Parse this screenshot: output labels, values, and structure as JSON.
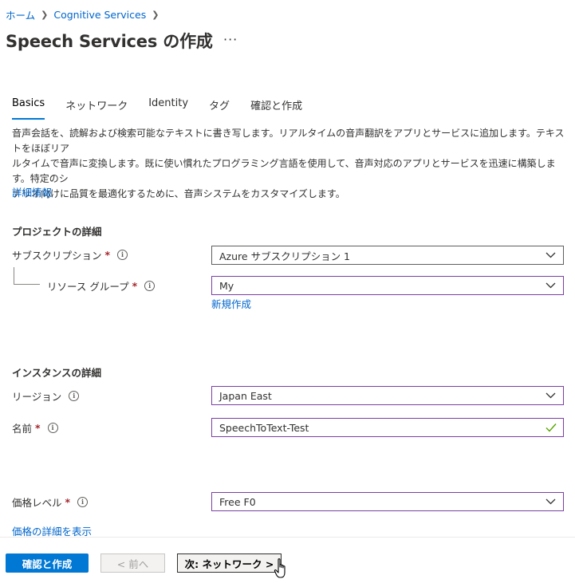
{
  "breadcrumb": {
    "home": "ホーム",
    "current": "Cognitive Services"
  },
  "page": {
    "title": "Speech Services の作成",
    "more": "···"
  },
  "tabs": [
    {
      "label": "Basics"
    },
    {
      "label": "ネットワーク"
    },
    {
      "label": "Identity"
    },
    {
      "label": "タグ"
    },
    {
      "label": "確認と作成"
    }
  ],
  "description": {
    "line1": "音声会話を、読解および検索可能なテキストに書き写します。リアルタイムの音声翻訳をアプリとサービスに追加します。テキストをほぼリア",
    "line2": "ルタイムで音声に変換します。既に使い慣れたプログラミング言語を使用して、音声対応のアプリとサービスを迅速に構築します。特定のシ",
    "line3": "ナリオ向けに品質を最適化するために、音声システムをカスタマイズします。",
    "learn_more": "詳細情報"
  },
  "project": {
    "title": "プロジェクトの詳細",
    "subscription_label": "サブスクリプション",
    "subscription_value": "Azure サブスクリプション 1",
    "resource_group_label": "リソース グループ",
    "resource_group_value": "My",
    "create_new": "新規作成"
  },
  "instance": {
    "title": "インスタンスの詳細",
    "region_label": "リージョン",
    "region_value": "Japan East",
    "name_label": "名前",
    "name_value": "SpeechToText-Test"
  },
  "pricing": {
    "label": "価格レベル",
    "value": "Free F0",
    "details_link": "価格の詳細を表示"
  },
  "footer": {
    "review_create": "確認と作成",
    "previous": "< 前へ",
    "next": "次: ネットワーク >"
  },
  "common": {
    "required_mark": "*",
    "info_glyph": "i"
  },
  "colors": {
    "accent": "#0078d4",
    "link": "#0066cc",
    "required": "#a4262c",
    "valid_check": "#57a300",
    "focus_border": "#7a3fa3"
  }
}
